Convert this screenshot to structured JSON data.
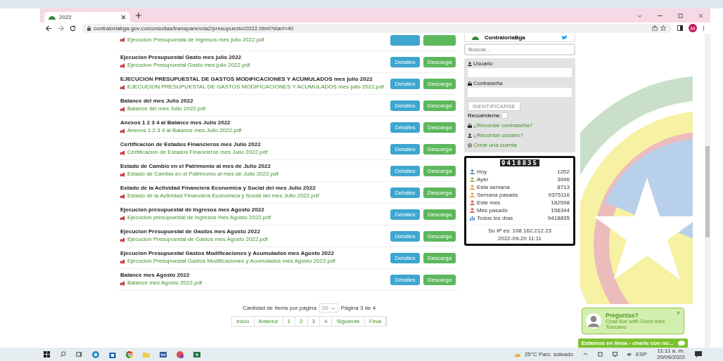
{
  "browser": {
    "tab_title": "2022",
    "url": "contraloriabga.gov.co/consultas/transparencia2/presupuesto/2022.html?start=40",
    "profile_initial": "M"
  },
  "documents": [
    {
      "link": "Ejecucion Presupuestal de Ingresos mes julio 2022.pdf"
    },
    {
      "title": "Ejecucion Presupuestal Gasto mes julio 2022",
      "link": "Ejecucion Presupuestal Gasto mes julio 2022.pdf",
      "details": "Detalles",
      "download": "Descarga"
    },
    {
      "title": "EJECUCION PRESUPUESTAL DE GASTOS MODIFICACIONES Y ACUMULADOS mes julio 2022",
      "link": "EJECUCION PRESUPUESTAL DE GASTOS MODIFICACIONES Y ACUMULADOS mes julio 2022.pdf",
      "details": "Detalles",
      "download": "Descarga"
    },
    {
      "title": "Balance del mes Julio 2022",
      "link": "Balance del mes Julio 2022.pdf",
      "details": "Detalles",
      "download": "Descarga"
    },
    {
      "title": "Anexos 1 2 3 4 al Balance mes Julio 2022",
      "link": "Anexos 1 2 3 4 al Balance mes Julio 2022.pdf",
      "details": "Detalles",
      "download": "Descarga"
    },
    {
      "title": "Certificacion de Estados Financieros mes Julio 2022",
      "link": "Certificacion de Estados Financieros mes Julio 2022.pdf",
      "details": "Detalles",
      "download": "Descarga"
    },
    {
      "title": "Estado de Cambio en el Patrimonio al mes de Julio 2022",
      "link": "Estado de Cambio en el Patrimonio al mes de Julio 2022.pdf",
      "details": "Detalles",
      "download": "Descarga"
    },
    {
      "title": "Estado de la Actividad Financiera Economica y Social del mes Julio 2022",
      "link": "Estado de la Actividad Financiera Economica y Social del mes Julio 2022.pdf",
      "details": "Detalles",
      "download": "Descarga"
    },
    {
      "title": "Ejecucion presupuestal de Ingresos mes Agosto 2022",
      "link": "Ejecucion presupuestal de Ingresos mes Agosto 2022.pdf",
      "details": "Detalles",
      "download": "Descarga"
    },
    {
      "title": "Ejecucion Presupuestal de Gastos mes Agosto 2022",
      "link": "Ejecucion Presupuestal de Gastos mes Agosto 2022.pdf",
      "details": "Detalles",
      "download": "Descarga"
    },
    {
      "title": "Ejecucion Presupuestal Gastos Modificaciones y Acumulados mes Agosto 2022",
      "link": "Ejecucion Presupuestal Gastos Modificaciones y Acumulados mes Agosto 2022.pdf",
      "details": "Detalles",
      "download": "Descarga"
    },
    {
      "title": "Balance mes Agosto 2022",
      "link": "Balance mes Agosto 2022.pdf",
      "details": "Detalles",
      "download": "Descarga"
    }
  ],
  "pagination": {
    "items_label": "Cantidad de ítems por página",
    "page_size": "20",
    "page_info": "Página 3 de 4",
    "pages": [
      "Inicio",
      "Anterior",
      "1",
      "2",
      "3",
      "4",
      "Siguiente",
      "Final"
    ]
  },
  "sidebar": {
    "twitter_name": "ContraloriaBga",
    "search_placeholder": "Buscar...",
    "login": {
      "user_label": "Usuario",
      "password_label": "Contraseña",
      "submit": "IDENTIFICARSE",
      "remember": "Recuérdeme",
      "remember_checked": false,
      "links": [
        {
          "label": "¿Recordar contraseña?",
          "kind": "lock"
        },
        {
          "label": "¿Recordar usuario?",
          "kind": "user"
        },
        {
          "label": "Crear una cuenta",
          "kind": "gear"
        }
      ]
    },
    "counter": {
      "total": "9418835",
      "stats": [
        {
          "label": "Hoy",
          "value": "1202",
          "kind": "person",
          "color": "#4a7fc1"
        },
        {
          "label": "Ayer",
          "value": "3096",
          "kind": "person",
          "color": "#8bb34a"
        },
        {
          "label": "Esta semana",
          "value": "8713",
          "kind": "person",
          "color": "#e89a2c"
        },
        {
          "label": "Semana pasada",
          "value": "9375116",
          "kind": "person",
          "color": "#e89a2c"
        },
        {
          "label": "Este mes",
          "value": "182598",
          "kind": "person",
          "color": "#d9534f"
        },
        {
          "label": "Mes pasado",
          "value": "156344",
          "kind": "person",
          "color": "#d9534f"
        },
        {
          "label": "Todos los días",
          "value": "9418835",
          "kind": "chart",
          "color": "#5b8fd0"
        }
      ],
      "ip": "Su IP es: 108.162.212.23",
      "datetime": "2022-09-20 11:11"
    }
  },
  "chat": {
    "title": "Preguntas?",
    "subtitle": "Chat live with Dora Inés Toscano",
    "bar": "Estamos en linea - charle con no..."
  },
  "taskbar": {
    "weather": "25°C  Parc. soleado",
    "language": "ESP",
    "time": "11:11 a. m.",
    "date": "20/09/2022"
  }
}
